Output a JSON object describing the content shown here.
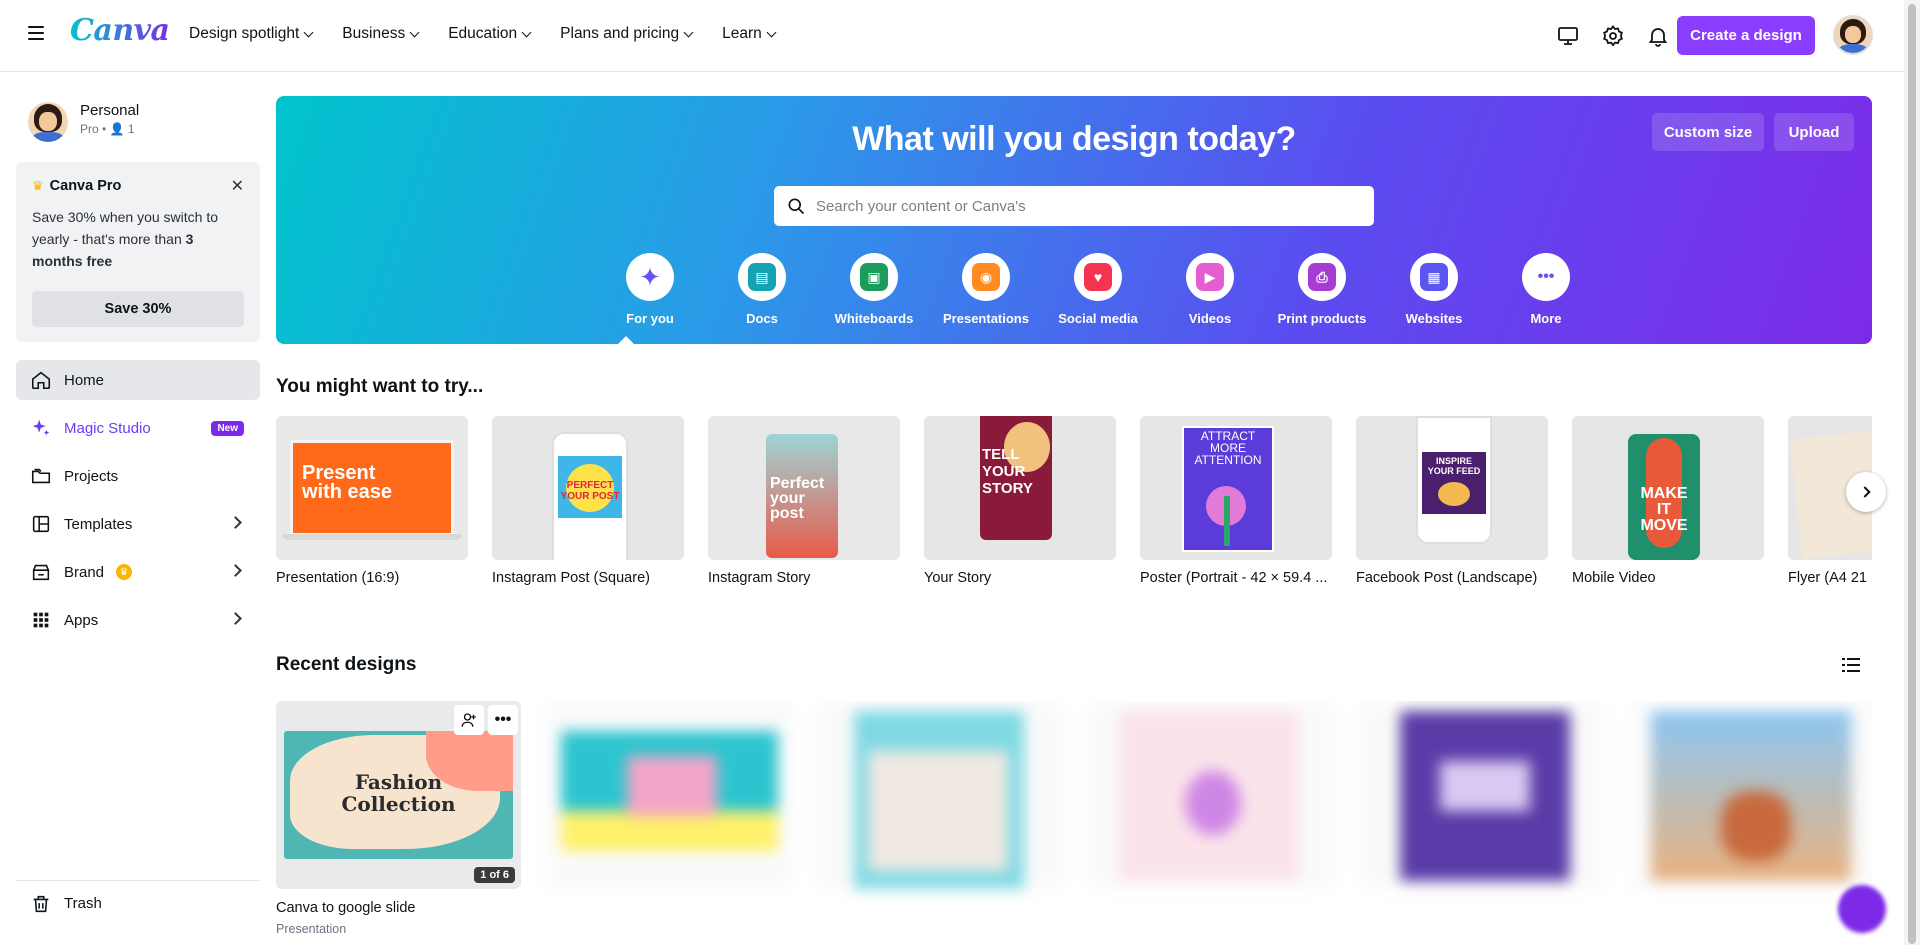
{
  "header": {
    "logo": "Canva",
    "nav": [
      "Design spotlight",
      "Business",
      "Education",
      "Plans and pricing",
      "Learn"
    ],
    "create_label": "Create a design"
  },
  "sidebar": {
    "account_name": "Personal",
    "account_sub": "Pro • 👤 1",
    "promo": {
      "title": "Canva Pro",
      "body_prefix": "Save 30% when you switch to yearly - that's more than ",
      "body_bold": "3 months free",
      "button": "Save 30%"
    },
    "items": [
      {
        "label": "Home",
        "icon": "home-icon"
      },
      {
        "label": "Magic Studio",
        "icon": "sparkle-icon",
        "badge": "New"
      },
      {
        "label": "Projects",
        "icon": "folder-icon"
      },
      {
        "label": "Templates",
        "icon": "template-icon"
      },
      {
        "label": "Brand",
        "icon": "brand-icon"
      },
      {
        "label": "Apps",
        "icon": "apps-grid-icon"
      }
    ],
    "trash": "Trash"
  },
  "hero": {
    "title": "What will you design today?",
    "custom_size": "Custom size",
    "upload": "Upload",
    "search_placeholder": "Search your content or Canva's",
    "categories": [
      {
        "label": "For you",
        "color": "#6453f7",
        "icon": "sparkle-icon"
      },
      {
        "label": "Docs",
        "color": "#13a3b5",
        "icon": "doc-icon"
      },
      {
        "label": "Whiteboards",
        "color": "#1a9d5b",
        "icon": "whiteboard-icon"
      },
      {
        "label": "Presentations",
        "color": "#ff8a1f",
        "icon": "presentation-icon"
      },
      {
        "label": "Social media",
        "color": "#f5344f",
        "icon": "heart-icon"
      },
      {
        "label": "Videos",
        "color": "#e65dd0",
        "icon": "video-icon"
      },
      {
        "label": "Print products",
        "color": "#a83bd6",
        "icon": "printer-icon"
      },
      {
        "label": "Websites",
        "color": "#5a56f0",
        "icon": "website-icon"
      },
      {
        "label": "More",
        "color": "#6453f7",
        "icon": "more-icon"
      }
    ]
  },
  "try_section": {
    "title": "You might want to try...",
    "items": [
      {
        "label": "Presentation (16:9)",
        "thumb_text": "Present with ease"
      },
      {
        "label": "Instagram Post (Square)",
        "thumb_text": "PERFECT YOUR POST"
      },
      {
        "label": "Instagram Story",
        "thumb_text": "Perfect your post"
      },
      {
        "label": "Your Story",
        "thumb_text": "TELL YOUR STORY"
      },
      {
        "label": "Poster (Portrait - 42 × 59.4 ...",
        "thumb_text": "ATTRACT MORE ATTENTION"
      },
      {
        "label": "Facebook Post (Landscape)",
        "thumb_text": "INSPIRE YOUR FEED"
      },
      {
        "label": "Mobile Video",
        "thumb_text": "MAKE IT MOVE"
      },
      {
        "label": "Flyer (A4 21",
        "thumb_text": ""
      }
    ]
  },
  "recent": {
    "title": "Recent designs",
    "items": [
      {
        "title": "Canva to google slide",
        "type": "Presentation",
        "thumb_text": "Fashion Collection",
        "page_count": "1 of 6"
      },
      {
        "title": "",
        "type": "",
        "thumb_text": ""
      },
      {
        "title": "",
        "type": "",
        "thumb_text": ""
      },
      {
        "title": "",
        "type": "",
        "thumb_text": ""
      },
      {
        "title": "",
        "type": "",
        "thumb_text": ""
      },
      {
        "title": "",
        "type": "",
        "thumb_text": ""
      }
    ]
  }
}
